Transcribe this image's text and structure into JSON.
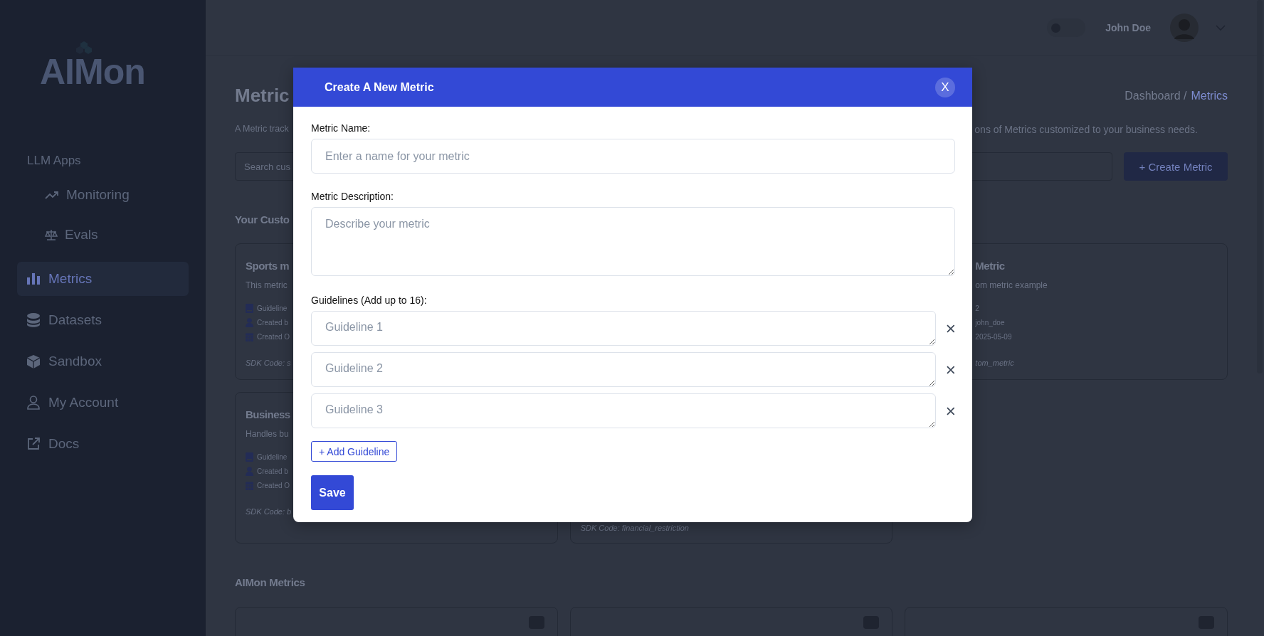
{
  "sidebar": {
    "logo": "AIMon",
    "groups": [
      {
        "label": "LLM Apps",
        "children": [
          {
            "label": "Monitoring",
            "selected": false
          },
          {
            "label": "Evals",
            "selected": false
          }
        ]
      }
    ],
    "items": [
      {
        "label": "Metrics",
        "selected": true
      },
      {
        "label": "Datasets",
        "selected": false
      },
      {
        "label": "Sandbox",
        "selected": false
      },
      {
        "label": "My Account",
        "selected": false
      },
      {
        "label": "Docs",
        "selected": false
      }
    ]
  },
  "header": {
    "theme_toggle": {
      "on": false
    },
    "user_name": "John Doe"
  },
  "page": {
    "title": "Metric",
    "breadcrumb": [
      {
        "label": "Dashboard /",
        "selected": false
      },
      {
        "label": "Metrics",
        "selected": true
      }
    ],
    "description_start": "A Metric track",
    "description_end": "ons of Metrics customized to your business needs.",
    "search": {
      "placeholder": "Search cus"
    },
    "create_button": "+ Create Metric",
    "custom_heading": "Your Custo",
    "custom_cards": [
      {
        "title": "Sports m",
        "description": "This metric",
        "guidelines": "Guideline",
        "created_by": "Created b",
        "created_on": "Created O",
        "sdk": "SDK Code: s"
      },
      {
        "title": "Metric",
        "description": "om metric example",
        "guidelines": "2",
        "created_by": "john_doe",
        "created_on": "2025-05-09",
        "sdk": "tom_metric"
      },
      {
        "title": "Business",
        "description": "Handles bu",
        "guidelines": "Guideline",
        "created_by": "Created b",
        "created_on": "Created O",
        "sdk": "SDK Code: b"
      },
      {
        "sdk": "SDK Code: financial_restriction"
      }
    ],
    "aimon_heading": "AIMon Metrics"
  },
  "modal": {
    "title": "Create A New Metric",
    "close": "X",
    "name_label": "Metric Name:",
    "name_placeholder": "Enter a name for your metric",
    "description_label": "Metric Description:",
    "description_placeholder": "Describe your metric",
    "guidelines_label": "Guidelines (Add up to 16):",
    "guidelines": [
      {
        "placeholder": "Guideline 1"
      },
      {
        "placeholder": "Guideline 2"
      },
      {
        "placeholder": "Guideline 3"
      }
    ],
    "add_button": "+ Add Guideline",
    "save_button": "Save"
  }
}
